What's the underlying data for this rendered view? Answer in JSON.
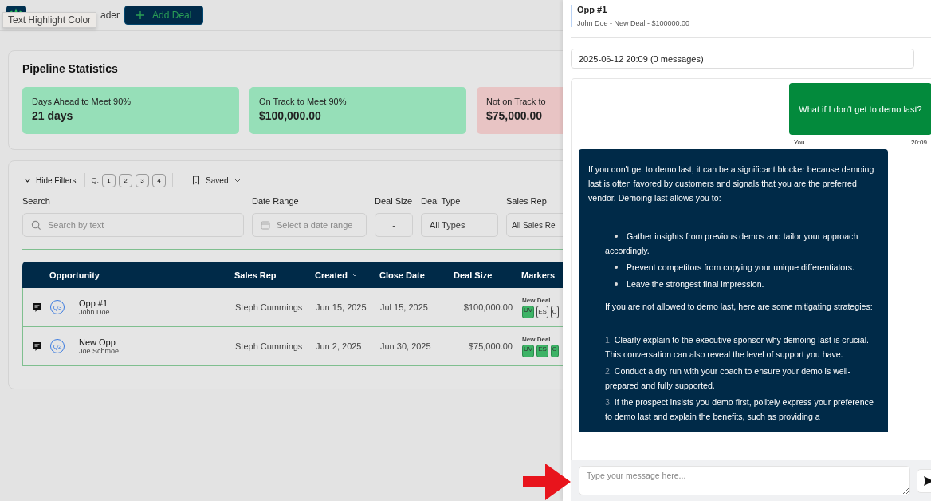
{
  "toolbar": {
    "tooltip": "Text Highlight Color",
    "brand_fragment": "ader",
    "add_button": "Add Deal"
  },
  "stats": {
    "title": "Pipeline Statistics",
    "cards": [
      {
        "label": "Days Ahead to Meet 90%",
        "value": "21 days",
        "kind": "good"
      },
      {
        "label": "On Track to Meet 90%",
        "value": "$100,000.00",
        "kind": "good"
      },
      {
        "label": "Not on Track to",
        "value": "$75,000.00",
        "kind": "bad"
      }
    ]
  },
  "filters": {
    "toggle": "Hide Filters",
    "quarter_label": "Q:",
    "quarters": [
      "1",
      "2",
      "3",
      "4"
    ],
    "saved": "Saved",
    "search": {
      "label": "Search",
      "placeholder": "Search by text"
    },
    "date_range": {
      "label": "Date Range",
      "placeholder": "Select a date range"
    },
    "deal_size": {
      "label": "Deal Size",
      "value": "-"
    },
    "deal_type": {
      "label": "Deal Type",
      "value": "All Types"
    },
    "sales_rep": {
      "label": "Sales Rep",
      "value": "All Sales Re"
    }
  },
  "table": {
    "columns": [
      {
        "label": "Opportunity",
        "sorted": false
      },
      {
        "label": "Sales Rep",
        "sorted": false
      },
      {
        "label": "Created",
        "sorted": true
      },
      {
        "label": "Close Date",
        "sorted": false
      },
      {
        "label": "Deal Size",
        "sorted": false
      },
      {
        "label": "Markers",
        "sorted": false
      }
    ],
    "rows": [
      {
        "quarter": "Q3",
        "name": "Opp #1",
        "contact": "John Doe",
        "sales_rep": "Steph Cummings",
        "created": "Jun 15, 2025",
        "close_date": "Jul 15, 2025",
        "deal_size": "$100,000.00",
        "marker_title": "New Deal",
        "markers": [
          {
            "label": "UV",
            "active": true
          },
          {
            "label": "ES",
            "active": false
          },
          {
            "label": "C",
            "active": false
          }
        ]
      },
      {
        "quarter": "Q2",
        "name": "New Opp",
        "contact": "Joe Schmoe",
        "sales_rep": "Steph Cummings",
        "created": "Jun 2, 2025",
        "close_date": "Jun 30, 2025",
        "deal_size": "$75,000.00",
        "marker_title": "New Deal",
        "markers": [
          {
            "label": "UV",
            "active": true
          },
          {
            "label": "ES",
            "active": true
          },
          {
            "label": "C",
            "active": true
          }
        ]
      }
    ]
  },
  "chat": {
    "title": "Opp #1",
    "subtitle": "John Doe - New Deal - $100000.00",
    "session": "2025-06-12 20:09 (0 messages)",
    "messages": [
      {
        "kind": "user",
        "text": "What if I don't get to demo last?",
        "sender": "You",
        "time": "20:09"
      },
      {
        "kind": "assistant",
        "blocks": [
          {
            "kind": "paragraph",
            "text": "If you don't get to demo last, it can be a significant blocker because demoing last is often favored by customers and signals that you are the preferred vendor. Demoing last allows you to:"
          },
          {
            "kind": "bullets",
            "items": [
              "Gather insights from previous demos and tailor your approach accordingly.",
              "Prevent competitors from copying your unique differentiators.",
              "Leave the strongest final impression."
            ]
          },
          {
            "kind": "paragraph",
            "text": "If you are not allowed to demo last, here are some mitigating strategies:"
          },
          {
            "kind": "numbered",
            "items": [
              {
                "number": "1.",
                "text": "Clearly explain to the executive sponsor why demoing last is crucial. This conversation can also reveal the level of support you have."
              },
              {
                "number": "2.",
                "text": "Conduct a dry run with your coach to ensure your demo is well-prepared and fully supported."
              },
              {
                "number": "3.",
                "text": "If the prospect insists you demo first, politely express your preference to demo last and explain the benefits, such as providing a"
              }
            ]
          }
        ]
      }
    ],
    "input": {
      "placeholder": "Type your message here..."
    }
  }
}
